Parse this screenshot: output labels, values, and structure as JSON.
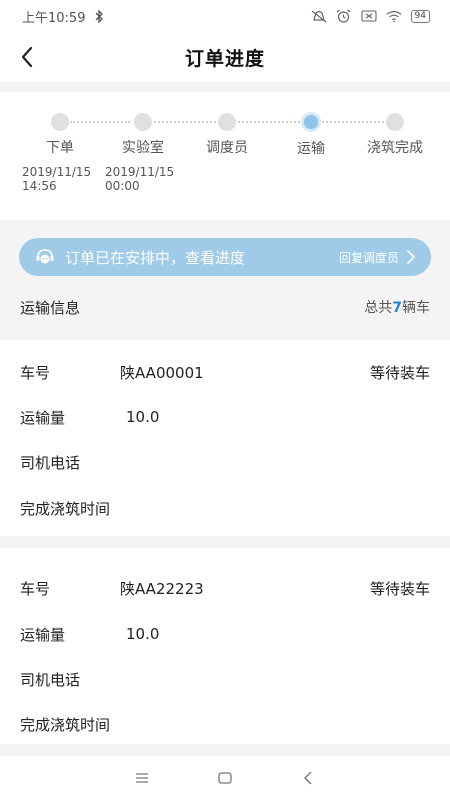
{
  "status_bar": {
    "time": "上午10:59",
    "battery": "94",
    "icons": [
      "bluetooth-icon",
      "mute-icon",
      "alarm-icon",
      "sim-icon",
      "wifi-icon",
      "battery-icon"
    ]
  },
  "header": {
    "title": "订单进度",
    "back_icon": "chevron-left-icon"
  },
  "progress": {
    "steps": [
      {
        "label": "下单",
        "active": false
      },
      {
        "label": "实验室",
        "active": false
      },
      {
        "label": "调度员",
        "active": false
      },
      {
        "label": "运输",
        "active": true
      },
      {
        "label": "浇筑完成",
        "active": false
      }
    ],
    "times": [
      {
        "date": "2019/11/15",
        "time": "14:56"
      },
      {
        "date": "2019/11/15",
        "time": "00:00"
      }
    ]
  },
  "notice": {
    "text": "订单已在安排中，查看进度",
    "action": "回复调度员",
    "icon": "dispatcher-avatar-icon",
    "color": "#9fcbe9"
  },
  "transport": {
    "title": "运输信息",
    "total_prefix": "总共",
    "total_count": "7",
    "total_suffix": "辆车",
    "accent": "#1c86d9"
  },
  "vehicles": [
    {
      "plate_label": "车号",
      "plate": "陕AA00001",
      "status": "等待装车",
      "volume_label": "运输量",
      "volume": "10.0",
      "phone_label": "司机电话",
      "phone": "",
      "finish_label": "完成浇筑时间",
      "finish": ""
    },
    {
      "plate_label": "车号",
      "plate": "陕AA22223",
      "status": "等待装车",
      "volume_label": "运输量",
      "volume": "10.0",
      "phone_label": "司机电话",
      "phone": "",
      "finish_label": "完成浇筑时间",
      "finish": ""
    }
  ],
  "nav": {
    "icons": [
      "menu-icon",
      "home-icon",
      "back-icon"
    ]
  }
}
